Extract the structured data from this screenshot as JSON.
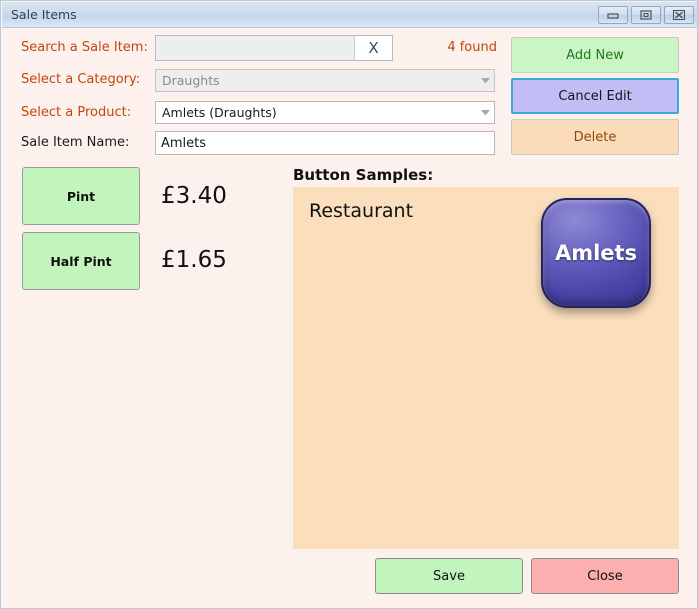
{
  "window": {
    "title": "Sale Items",
    "controls": {
      "minimize": "minimize-icon",
      "maximize": "maximize-icon",
      "close": "close-icon"
    }
  },
  "form": {
    "search": {
      "label": "Search a Sale Item:",
      "value": "",
      "placeholder": "",
      "clear_label": "X",
      "found_text": "4 found"
    },
    "category": {
      "label": "Select a Category:",
      "value": "Draughts",
      "disabled": true
    },
    "product": {
      "label": "Select a Product:",
      "value": "Amlets (Draughts)",
      "disabled": false
    },
    "item_name": {
      "label": "Sale Item Name:",
      "value": "Amlets"
    }
  },
  "actions": {
    "add_new": "Add New",
    "cancel_edit": "Cancel Edit",
    "delete": "Delete"
  },
  "sizes": [
    {
      "label": "Pint",
      "price": "£3.40"
    },
    {
      "label": "Half Pint",
      "price": "£1.65"
    }
  ],
  "samples": {
    "title": "Button Samples:",
    "group_label": "Restaurant",
    "button_label": "Amlets"
  },
  "footer": {
    "save": "Save",
    "close": "Close"
  },
  "colors": {
    "window_background": "#fdf1ee",
    "titlebar": "#cddcec",
    "label_accent": "#c0470f",
    "green_button": "#c2f5be",
    "purple_button": "#c2bdf5",
    "orange_button": "#fbdcb8",
    "pink_button": "#fbafaf",
    "panel_peach": "#fbdfbd",
    "sample_button": "#4a45a8"
  }
}
